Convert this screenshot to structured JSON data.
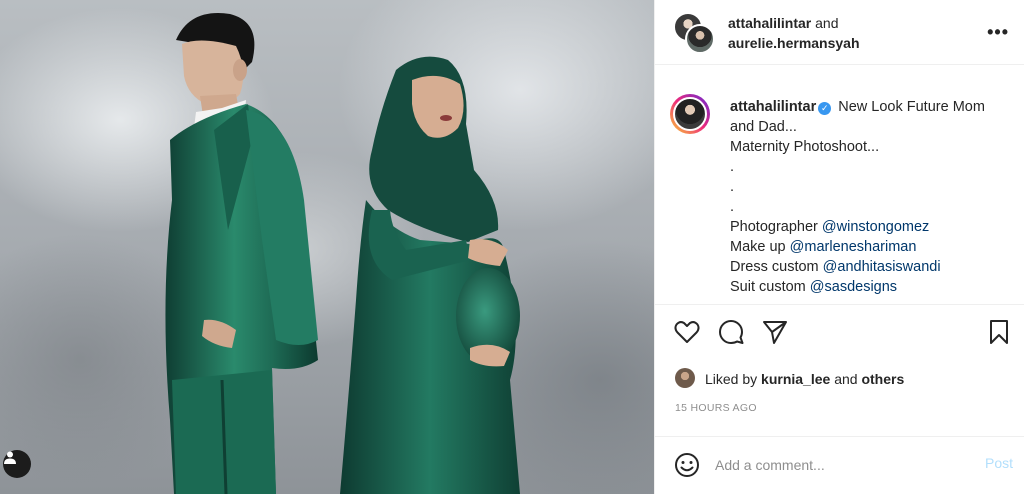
{
  "header": {
    "user1": "attahalilintar",
    "and_text": " and",
    "user2": "aurelie.hermansyah",
    "more_glyph": "•••"
  },
  "caption": {
    "username": "attahalilintar",
    "verified_glyph": "✓",
    "line1": " New Look Future Mom",
    "line2": "and Dad...",
    "line3": "Maternity Photoshoot...",
    "dot1": ".",
    "dot2": ".",
    "dot3": ".",
    "photographer_label": "Photographer ",
    "photographer_mention": "@winstongomez",
    "makeup_label": "Make up ",
    "makeup_mention": "@marleneshariman",
    "dress_label": "Dress custom ",
    "dress_mention": "@andhitasiswandi",
    "suit_label": "Suit custom ",
    "suit_mention": "@sasdesigns"
  },
  "actions": {
    "like": "heart-icon",
    "comment": "comment-icon",
    "share": "send-icon",
    "save": "bookmark-icon"
  },
  "likes": {
    "prefix": "Liked by ",
    "user": "kurnia_lee",
    "middle": " and ",
    "suffix": "others"
  },
  "timestamp": "15 HOURS AGO",
  "comment": {
    "placeholder": "Add a comment...",
    "post_label": "Post"
  },
  "colors": {
    "mention": "#00376b",
    "post_disabled": "#b2dffc",
    "verified": "#3897f0",
    "suit_green": "#1f6b55",
    "dress_green": "#18584a"
  }
}
